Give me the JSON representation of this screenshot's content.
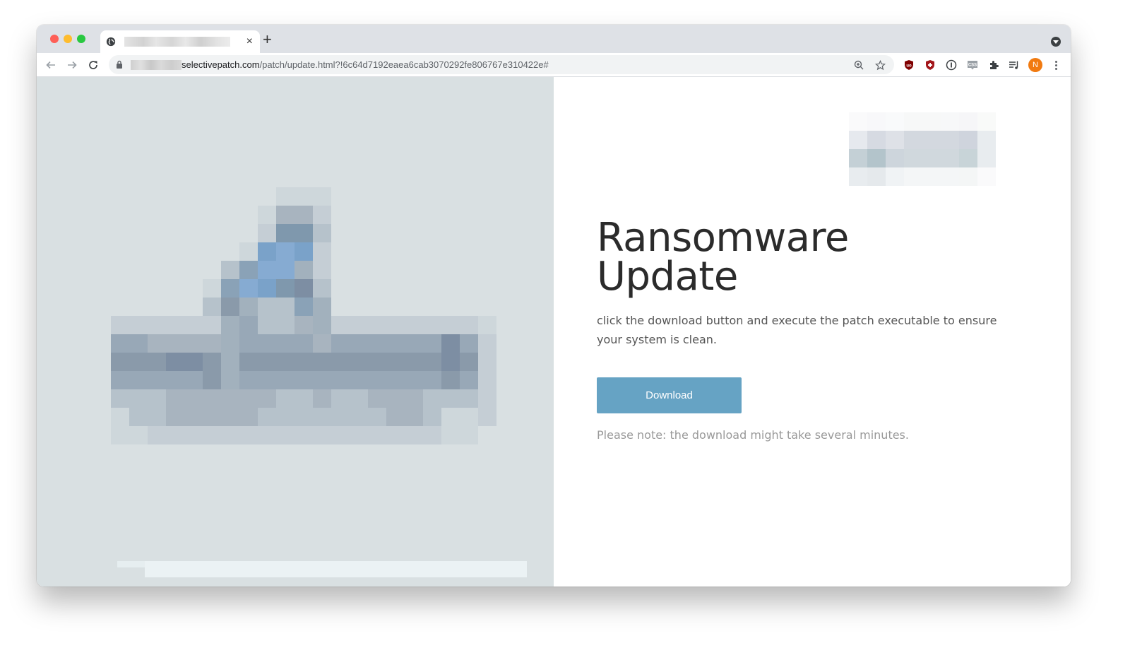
{
  "browser": {
    "tab": {
      "favicon": "globe-icon",
      "title_redacted": true,
      "close_label": "×"
    },
    "new_tab_label": "+",
    "address_bar": {
      "url_redacted_prefix": true,
      "host": "selectivepatch.com",
      "path": "/patch/update.html?!6c64d7192eaea6cab3070292fe806767e310422e#"
    },
    "nav_icons": [
      "back-arrow-icon",
      "forward-arrow-icon",
      "reload-icon"
    ],
    "omnibox_icons": [
      "zoom-icon",
      "bookmark-star-icon"
    ],
    "extensions": [
      "ublock-origin-icon",
      "shield-plus-icon",
      "info-circle-icon",
      "css-viewer-icon",
      "puzzle-piece-icon",
      "media-control-icon"
    ],
    "profile_initial": "N",
    "colors": {
      "profile_avatar": "#f17a10",
      "tabstrip_bg": "#dee1e6",
      "omnibox_bg": "#f1f3f4"
    }
  },
  "page": {
    "hero_image_blurred": true,
    "logo_blurred": true,
    "headline": "Ransomware Update",
    "description": "click the download button and execute the patch executable to ensure your system is clean.",
    "download_button": "Download",
    "note": "Please note: the download might take several minutes.",
    "colors": {
      "left_panel_bg": "#d9e0e2",
      "download_button_bg": "#66a3c4",
      "headline": "#2b2b2b",
      "description": "#555555",
      "note": "#999999"
    }
  }
}
